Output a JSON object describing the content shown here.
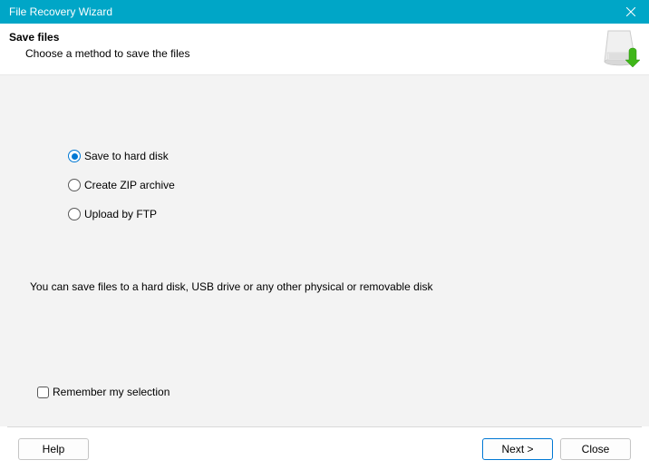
{
  "titlebar": {
    "title": "File Recovery Wizard"
  },
  "header": {
    "title": "Save files",
    "subtitle": "Choose a method to save the files"
  },
  "options": [
    {
      "label": "Save to hard disk",
      "selected": true
    },
    {
      "label": "Create ZIP archive",
      "selected": false
    },
    {
      "label": "Upload by FTP",
      "selected": false
    }
  ],
  "description": "You can save files to a hard disk, USB drive or any other physical or removable disk",
  "remember": {
    "label": "Remember my selection",
    "checked": false
  },
  "footer": {
    "help": "Help",
    "next": "Next >",
    "close": "Close"
  }
}
